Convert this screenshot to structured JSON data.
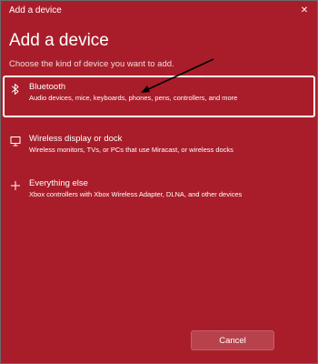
{
  "window": {
    "title": "Add a device",
    "close_symbol": "✕"
  },
  "header": {
    "heading": "Add a device",
    "subtitle": "Choose the kind of device you want to add."
  },
  "options": [
    {
      "title": "Bluetooth",
      "description": "Audio devices, mice, keyboards, phones, pens, controllers, and more",
      "icon": "bluetooth-icon",
      "selected": true
    },
    {
      "title": "Wireless display or dock",
      "description": "Wireless monitors, TVs, or PCs that use Miracast, or wireless docks",
      "icon": "monitor-icon",
      "selected": false
    },
    {
      "title": "Everything else",
      "description": "Xbox controllers with Xbox Wireless Adapter, DLNA, and other devices",
      "icon": "plus-icon",
      "selected": false
    }
  ],
  "footer": {
    "cancel_label": "Cancel"
  },
  "colors": {
    "background": "#a91d2a",
    "text": "#ffffff",
    "selection_border": "#ffffff",
    "annotation_arrow": "#000000"
  }
}
